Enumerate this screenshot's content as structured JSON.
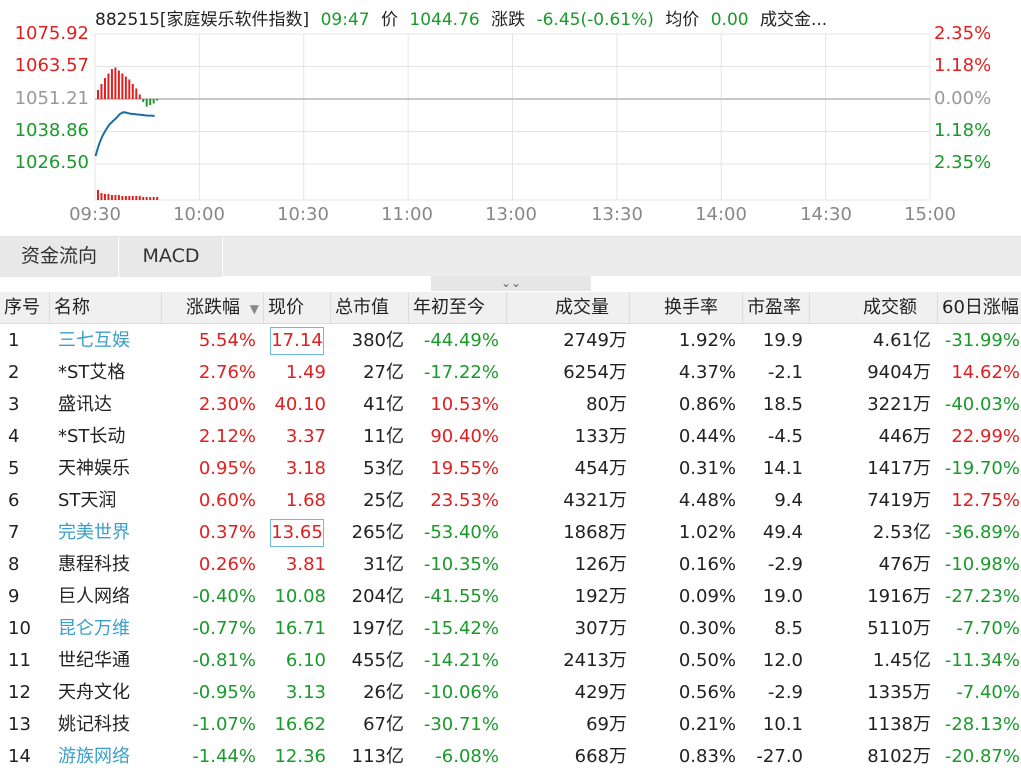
{
  "header": {
    "code_name": "882515[家庭娱乐软件指数]",
    "time": "09:47",
    "price_label": "价",
    "price": "1044.76",
    "change_label": "涨跌",
    "change": "-6.45(-0.61%)",
    "avg_label": "均价",
    "avg": "0.00",
    "turnover_label": "成交金..."
  },
  "chart": {
    "y_left": [
      "1075.92",
      "1063.57",
      "1051.21",
      "1038.86",
      "1026.50"
    ],
    "y_right": [
      "2.35%",
      "1.18%",
      "0.00%",
      "1.18%",
      "2.35%"
    ],
    "x_labels": [
      "09:30",
      "10:00",
      "10:30",
      "11:00",
      "13:00",
      "13:30",
      "14:00",
      "14:30",
      "15:00"
    ],
    "colors": {
      "up": "#e02020",
      "down": "#1a9a2a",
      "line": "#1a6fa0",
      "flat": "#999999"
    }
  },
  "chart_data": {
    "type": "line",
    "title": "882515[家庭娱乐软件指数]",
    "xlabel": "",
    "ylabel": "",
    "ylim": [
      1026.5,
      1075.92
    ],
    "baseline": 1051.21,
    "series": [
      {
        "name": "",
        "x": [
          "09:30",
          "09:31",
          "09:32",
          "09:33",
          "09:34",
          "09:35",
          "09:36",
          "09:37",
          "09:38",
          "09:39",
          "09:40",
          "09:41",
          "09:42",
          "09:43",
          "09:44",
          "09:45",
          "09:46",
          "09:47"
        ],
        "values": [
          1029.5,
          1034.0,
          1037.2,
          1039.5,
          1041.5,
          1042.8,
          1044.0,
          1045.5,
          1046.2,
          1046.0,
          1045.6,
          1045.5,
          1045.3,
          1045.2,
          1045.0,
          1044.9,
          1044.9,
          1044.76
        ]
      }
    ],
    "diff_bars": [
      3.0,
      5.0,
      7.0,
      8.5,
      10.0,
      10.5,
      9.5,
      8.5,
      7.5,
      6.5,
      5.0,
      3.5,
      1.5,
      -1.0,
      -2.5,
      -2.0,
      -1.5,
      -0.5
    ],
    "volume_bars": [
      10,
      7,
      6,
      6,
      5,
      5,
      5,
      4,
      4,
      4,
      4,
      4,
      4,
      3,
      3,
      3,
      3,
      3
    ]
  },
  "tabs": [
    "资金流向",
    "MACD"
  ],
  "collapse_icon": "double-chevron-down",
  "table": {
    "columns": [
      "序号",
      "名称",
      "涨跌幅",
      "现价",
      "总市值",
      "年初至今",
      "成交量",
      "换手率",
      "市盈率",
      "成交额",
      "60日涨幅"
    ],
    "sort_indicator": "▼",
    "rows": [
      {
        "no": "1",
        "name": "三七互娱",
        "chg": "5.54%",
        "price": "17.14",
        "mcap": "380亿",
        "ytd": "-44.49%",
        "vol": "2749万",
        "turn": "1.92%",
        "pe": "19.9",
        "amt": "4.61亿",
        "d60": "-31.99%",
        "link": true,
        "boxed": true
      },
      {
        "no": "2",
        "name": "*ST艾格",
        "chg": "2.76%",
        "price": "1.49",
        "mcap": "27亿",
        "ytd": "-17.22%",
        "vol": "6254万",
        "turn": "4.37%",
        "pe": "-2.1",
        "amt": "9404万",
        "d60": "14.62%",
        "link": false,
        "boxed": false
      },
      {
        "no": "3",
        "name": "盛讯达",
        "chg": "2.30%",
        "price": "40.10",
        "mcap": "41亿",
        "ytd": "10.53%",
        "vol": "80万",
        "turn": "0.86%",
        "pe": "18.5",
        "amt": "3221万",
        "d60": "-40.03%",
        "link": false,
        "boxed": false
      },
      {
        "no": "4",
        "name": "*ST长动",
        "chg": "2.12%",
        "price": "3.37",
        "mcap": "11亿",
        "ytd": "90.40%",
        "vol": "133万",
        "turn": "0.44%",
        "pe": "-4.5",
        "amt": "446万",
        "d60": "22.99%",
        "link": false,
        "boxed": false
      },
      {
        "no": "5",
        "name": "天神娱乐",
        "chg": "0.95%",
        "price": "3.18",
        "mcap": "53亿",
        "ytd": "19.55%",
        "vol": "454万",
        "turn": "0.31%",
        "pe": "14.1",
        "amt": "1417万",
        "d60": "-19.70%",
        "link": false,
        "boxed": false
      },
      {
        "no": "6",
        "name": "ST天润",
        "chg": "0.60%",
        "price": "1.68",
        "mcap": "25亿",
        "ytd": "23.53%",
        "vol": "4321万",
        "turn": "4.48%",
        "pe": "9.4",
        "amt": "7419万",
        "d60": "12.75%",
        "link": false,
        "boxed": false
      },
      {
        "no": "7",
        "name": "完美世界",
        "chg": "0.37%",
        "price": "13.65",
        "mcap": "265亿",
        "ytd": "-53.40%",
        "vol": "1868万",
        "turn": "1.02%",
        "pe": "49.4",
        "amt": "2.53亿",
        "d60": "-36.89%",
        "link": true,
        "boxed": true
      },
      {
        "no": "8",
        "name": "惠程科技",
        "chg": "0.26%",
        "price": "3.81",
        "mcap": "31亿",
        "ytd": "-10.35%",
        "vol": "126万",
        "turn": "0.16%",
        "pe": "-2.9",
        "amt": "476万",
        "d60": "-10.98%",
        "link": false,
        "boxed": false
      },
      {
        "no": "9",
        "name": "巨人网络",
        "chg": "-0.40%",
        "price": "10.08",
        "mcap": "204亿",
        "ytd": "-41.55%",
        "vol": "192万",
        "turn": "0.09%",
        "pe": "19.0",
        "amt": "1916万",
        "d60": "-27.23%",
        "link": false,
        "boxed": false
      },
      {
        "no": "10",
        "name": "昆仑万维",
        "chg": "-0.77%",
        "price": "16.71",
        "mcap": "197亿",
        "ytd": "-15.42%",
        "vol": "307万",
        "turn": "0.30%",
        "pe": "8.5",
        "amt": "5110万",
        "d60": "-7.70%",
        "link": true,
        "boxed": false
      },
      {
        "no": "11",
        "name": "世纪华通",
        "chg": "-0.81%",
        "price": "6.10",
        "mcap": "455亿",
        "ytd": "-14.21%",
        "vol": "2413万",
        "turn": "0.50%",
        "pe": "12.0",
        "amt": "1.45亿",
        "d60": "-11.34%",
        "link": false,
        "boxed": false
      },
      {
        "no": "12",
        "name": "天舟文化",
        "chg": "-0.95%",
        "price": "3.13",
        "mcap": "26亿",
        "ytd": "-10.06%",
        "vol": "429万",
        "turn": "0.56%",
        "pe": "-2.9",
        "amt": "1335万",
        "d60": "-7.40%",
        "link": false,
        "boxed": false
      },
      {
        "no": "13",
        "name": "姚记科技",
        "chg": "-1.07%",
        "price": "16.62",
        "mcap": "67亿",
        "ytd": "-30.71%",
        "vol": "69万",
        "turn": "0.21%",
        "pe": "10.1",
        "amt": "1138万",
        "d60": "-28.13%",
        "link": false,
        "boxed": false
      },
      {
        "no": "14",
        "name": "游族网络",
        "chg": "-1.44%",
        "price": "12.36",
        "mcap": "113亿",
        "ytd": "-6.08%",
        "vol": "668万",
        "turn": "0.83%",
        "pe": "-27.0",
        "amt": "8102万",
        "d60": "-20.87%",
        "link": true,
        "boxed": false
      }
    ]
  }
}
